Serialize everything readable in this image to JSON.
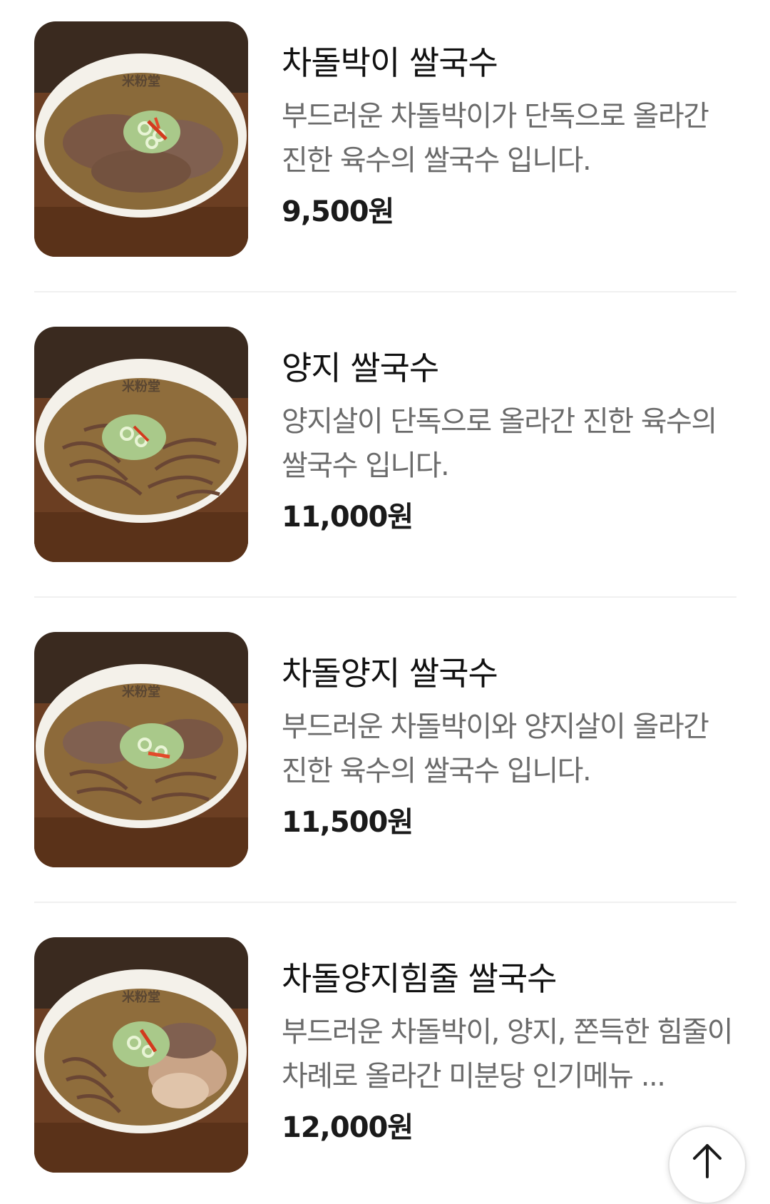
{
  "menu": {
    "items": [
      {
        "name": "차돌박이 쌀국수",
        "description": "부드러운 차돌박이가 단독으로 올라간 진한 육수의 쌀국수 입니다.",
        "price": "9,500원",
        "image_icon": "noodle-bowl-brisket"
      },
      {
        "name": "양지 쌀국수",
        "description": "양지살이 단독으로 올라간 진한 육수의 쌀국수 입니다.",
        "price": "11,000원",
        "image_icon": "noodle-bowl-flank"
      },
      {
        "name": "차돌양지 쌀국수",
        "description": "부드러운 차돌박이와 양지살이 올라간 진한 육수의 쌀국수 입니다.",
        "price": "11,500원",
        "image_icon": "noodle-bowl-brisket-flank"
      },
      {
        "name": "차돌양지힘줄 쌀국수",
        "description": "부드러운 차돌박이, 양지, 쫀득한 힘줄이 차례로 올라간 미분당 인기메뉴 ...",
        "price": "12,000원",
        "image_icon": "noodle-bowl-combo"
      }
    ],
    "bowl_label": "米粉堂"
  },
  "scroll_top": {
    "icon": "arrow-up-icon"
  },
  "colors": {
    "name_text": "#111111",
    "desc_text": "#6b6b6b",
    "price_text": "#1a1a1a",
    "divider": "#f0f0f0",
    "broth": "#8a6a3a",
    "background_wood": "#6b3e22"
  }
}
